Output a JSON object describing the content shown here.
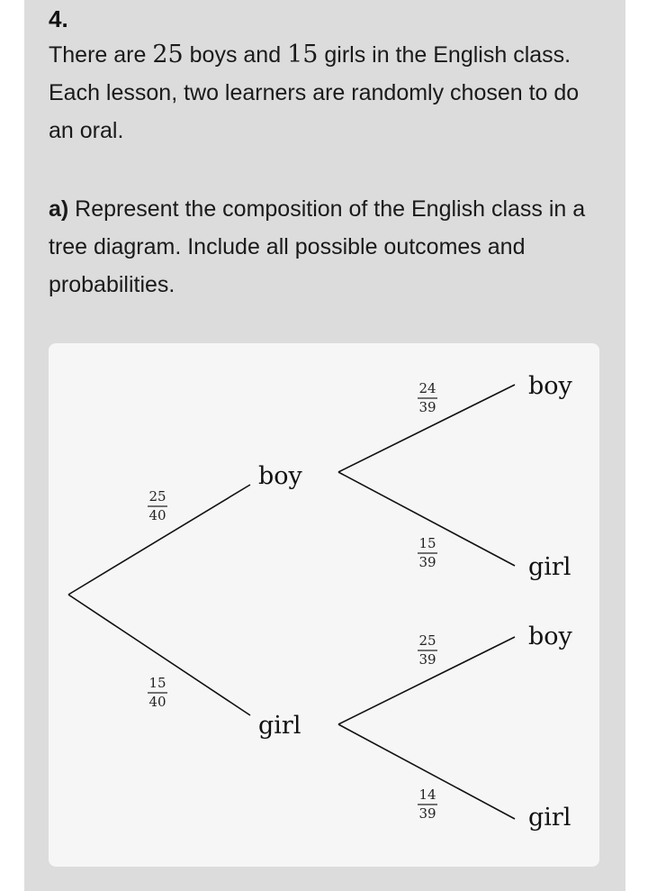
{
  "question": {
    "number": "4.",
    "intro": {
      "pre": "There are ",
      "boys_count": "25",
      "mid": " boys and ",
      "girls_count": "15",
      "post": " girls in the English class. Each lesson, two learners are randomly chosen to do an oral."
    },
    "part_a": {
      "label": "a)",
      "text": " Represent the composition of the English class in a tree diagram. Include all possible outcomes and probabilities."
    }
  },
  "tree": {
    "first": {
      "boy": {
        "label": "boy",
        "num": "25",
        "den": "40"
      },
      "girl": {
        "label": "girl",
        "num": "15",
        "den": "40"
      }
    },
    "after_boy": {
      "boy": {
        "label": "boy",
        "num": "24",
        "den": "39"
      },
      "girl": {
        "label": "girl",
        "num": "15",
        "den": "39"
      }
    },
    "after_girl": {
      "boy": {
        "label": "boy",
        "num": "25",
        "den": "39"
      },
      "girl": {
        "label": "girl",
        "num": "14",
        "den": "39"
      }
    }
  }
}
